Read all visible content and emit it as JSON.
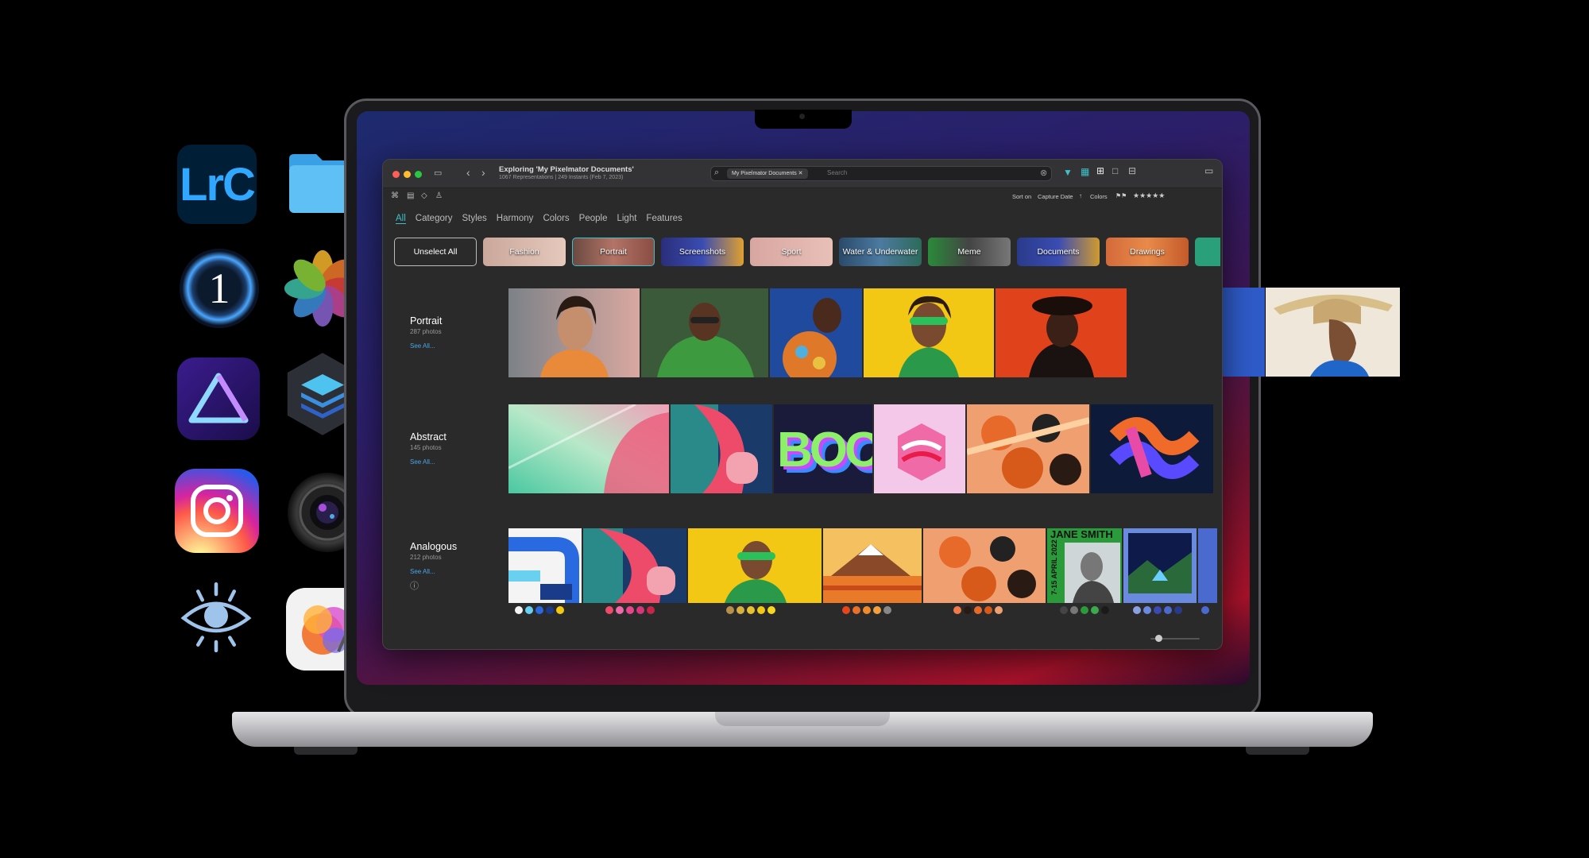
{
  "window": {
    "title": "Exploring 'My Pixelmator Documents'",
    "subtitle": "1067 Representations | 249 Instants (Feb 7, 2023)"
  },
  "search": {
    "token": "My Pixelmator Documents",
    "placeholder": "Search"
  },
  "sort": {
    "label": "Sort on",
    "value": "Capture Date",
    "colors_label": "Colors",
    "rating": "★★★★★"
  },
  "tabs": [
    "All",
    "Category",
    "Styles",
    "Harmony",
    "Colors",
    "People",
    "Light",
    "Features"
  ],
  "active_tab": "All",
  "unselect_label": "Unselect All",
  "chips": [
    "Fashion",
    "Portrait",
    "Screenshots",
    "Sport",
    "Water & Underwater",
    "Meme",
    "Documents",
    "Drawings"
  ],
  "sections": [
    {
      "title": "Portrait",
      "count": "287 photos",
      "see_all": "See All..."
    },
    {
      "title": "Abstract",
      "count": "145 photos",
      "see_all": "See All..."
    },
    {
      "title": "Analogous",
      "count": "212 photos",
      "see_all": "See All..."
    }
  ],
  "tile_text": {
    "boo": "BOO",
    "poster": "JANE SMITH",
    "poster_date": "7-15 APRIL 2022"
  },
  "apps": {
    "lrc": "LrC",
    "c1": "1"
  },
  "colors": {
    "accent": "#3fc0c9",
    "link": "#49a4e6"
  }
}
